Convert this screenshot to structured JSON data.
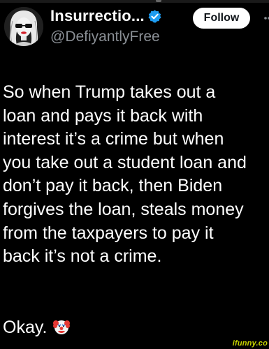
{
  "tweet": {
    "author": {
      "display_name": "Insurrectio...",
      "handle": "@DefiyantlyFree",
      "verified_icon": "verified-badge-icon",
      "verified_color": "#1d9bf0"
    },
    "follow_label": "Follow",
    "more_icon": "more-icon",
    "text_lines": [
      "So when Trump takes out a",
      "loan and pays it back with",
      "interest it’s a crime but when",
      "you take out a student loan and",
      "don’t pay it back, then Biden",
      "forgives the loan, steals money",
      "from the taxpayers to pay it",
      "back it’s not a crime."
    ],
    "closing_text": "Okay.",
    "closing_icon": "clown-face-icon"
  },
  "watermark": "ifunny.co",
  "colors": {
    "background": "#000000",
    "text": "#ffffff",
    "secondary_text": "#8a8f95",
    "follow_button_bg": "#ffffff",
    "follow_button_text": "#0f1419",
    "watermark": "#c8d400"
  }
}
